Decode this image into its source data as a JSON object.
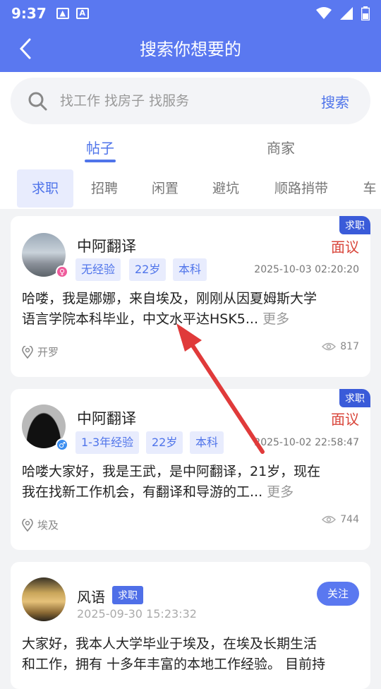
{
  "status_bar": {
    "time": "9:37"
  },
  "header": {
    "title": "搜索你想要的"
  },
  "search": {
    "placeholder": "找工作 找房子 找服务",
    "button": "搜索"
  },
  "tabs": [
    {
      "label": "帖子"
    },
    {
      "label": "商家"
    }
  ],
  "categories": [
    {
      "label": "求职"
    },
    {
      "label": "招聘"
    },
    {
      "label": "闲置"
    },
    {
      "label": "避坑"
    },
    {
      "label": "顺路捎带"
    },
    {
      "label": "车"
    }
  ],
  "posts": [
    {
      "badge": "求职",
      "name": "中阿翻译",
      "salary": "面议",
      "tags": [
        "无经验",
        "22岁",
        "本科"
      ],
      "date": "2025-10-03 02:20:20",
      "line1": "哈喽，我是娜娜，来自埃及，刚刚从因夏姆斯大学",
      "line2": "语言学院本科毕业，中文水平达HSK5...",
      "more": "更多",
      "location": "开罗",
      "views": "817",
      "gender": "♀"
    },
    {
      "badge": "求职",
      "name": "中阿翻译",
      "salary": "面议",
      "tags": [
        "1-3年经验",
        "22岁",
        "本科"
      ],
      "date": "2025-10-02 22:58:47",
      "line1": "哈喽大家好，我是王武，是中阿翻译，21岁，现在",
      "line2": "我在找新工作机会，有翻译和导游的工...",
      "more": "更多",
      "location": "埃及",
      "views": "744",
      "gender": "♂"
    },
    {
      "name": "风语",
      "badge": "求职",
      "date": "2025-09-30 15:23:32",
      "follow": "关注",
      "line1": "大家好，我本人大学毕业于埃及，在埃及长期生活",
      "line2": "和工作，拥有 十多年丰富的本地工作经验。 目前持"
    }
  ]
}
